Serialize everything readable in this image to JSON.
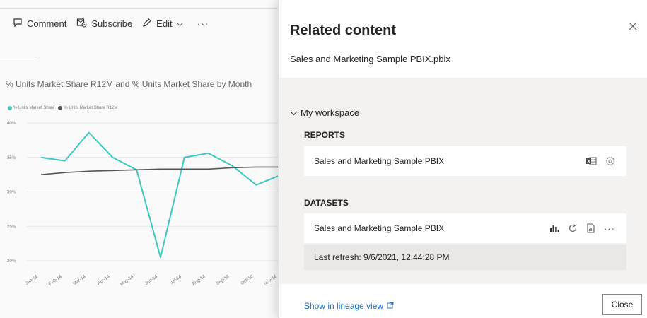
{
  "toolbar": {
    "comment_label": "Comment",
    "subscribe_label": "Subscribe",
    "edit_label": "Edit",
    "more_label": "···"
  },
  "report": {
    "chart_title": "% Units Market Share R12M and % Units Market Share by Month"
  },
  "chart_data": {
    "type": "line",
    "legend": [
      "% Units Market Share",
      "% Units Market Share R12M"
    ],
    "legend_position": "top-left",
    "categories": [
      "Jan-14",
      "Feb-14",
      "Mar-14",
      "Apr-14",
      "May-14",
      "Jun-14",
      "Jul-14",
      "Aug-14",
      "Sep-14",
      "Oct-14",
      "Nov-14"
    ],
    "y_ticks": [
      "40%",
      "35%",
      "30%",
      "25%",
      "20%"
    ],
    "ylim": [
      20,
      40
    ],
    "grid": true,
    "series": [
      {
        "name": "% Units Market Share",
        "color": "#3ec9bf",
        "values": [
          35.0,
          34.5,
          38.6,
          35.0,
          33.2,
          20.5,
          35.0,
          35.6,
          33.8,
          31.0,
          32.4
        ]
      },
      {
        "name": "% Units Market Share R12M",
        "color": "#555555",
        "values": [
          32.5,
          32.8,
          33.0,
          33.1,
          33.2,
          33.3,
          33.3,
          33.3,
          33.5,
          33.6,
          33.6
        ]
      }
    ]
  },
  "panel": {
    "title": "Related content",
    "subtitle": "Sales and Marketing Sample PBIX.pbix",
    "workspace_label": "My workspace",
    "reports_label": "REPORTS",
    "report_item": "Sales and Marketing Sample PBIX",
    "datasets_label": "DATASETS",
    "dataset_item": "Sales and Marketing Sample PBIX",
    "last_refresh": "Last refresh: 9/6/2021, 12:44:28 PM",
    "dataset_more": "···",
    "lineage_link": "Show in lineage view",
    "close_button": "Close"
  },
  "icons": {
    "comment": "comment-icon",
    "subscribe": "subscribe-icon",
    "edit": "pencil-icon",
    "close": "close-icon",
    "chevron": "chevron-down-icon",
    "excel": "excel-icon",
    "settings": "gear-icon",
    "analyze": "chart-icon",
    "refresh": "refresh-icon",
    "new_report": "new-report-icon",
    "external": "external-link-icon"
  },
  "colors": {
    "accent_link": "#1f6cc0",
    "series_primary": "#3ec9bf",
    "series_secondary": "#555555"
  }
}
